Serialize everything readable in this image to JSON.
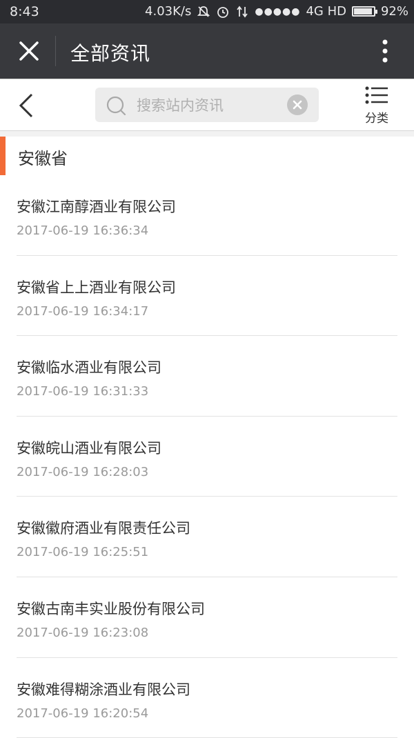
{
  "status_bar": {
    "time": "8:43",
    "net_speed": "4.03K/s",
    "signal_dots": "●●●●●",
    "network": "4G HD",
    "battery_level_percent": 92,
    "battery_text": "92%"
  },
  "top_bar": {
    "title": "全部资讯"
  },
  "search": {
    "placeholder": "搜索站内资讯",
    "value": ""
  },
  "category": {
    "label": "分类"
  },
  "section": {
    "title": "安徽省"
  },
  "items": [
    {
      "title": "安徽江南醇酒业有限公司",
      "date": "2017-06-19 16:36:34"
    },
    {
      "title": "安徽省上上酒业有限公司",
      "date": "2017-06-19 16:34:17"
    },
    {
      "title": "安徽临水酒业有限公司",
      "date": "2017-06-19 16:31:33"
    },
    {
      "title": "安徽皖山酒业有限公司",
      "date": "2017-06-19 16:28:03"
    },
    {
      "title": "安徽徽府酒业有限责任公司",
      "date": "2017-06-19 16:25:51"
    },
    {
      "title": "安徽古南丰实业股份有限公司",
      "date": "2017-06-19 16:23:08"
    },
    {
      "title": "安徽难得糊涂酒业有限公司",
      "date": "2017-06-19 16:20:54"
    }
  ],
  "colors": {
    "status_bar_bg": "#2b2c30",
    "top_bar_bg": "#38393d",
    "accent": "#f26b37",
    "date_text": "#9a9a9a"
  },
  "icons": [
    "close-icon",
    "more-vertical-icon",
    "back-chevron-icon",
    "search-icon",
    "clear-icon",
    "list-menu-icon",
    "mute-icon",
    "alarm-icon",
    "data-arrows-icon",
    "battery-icon"
  ]
}
